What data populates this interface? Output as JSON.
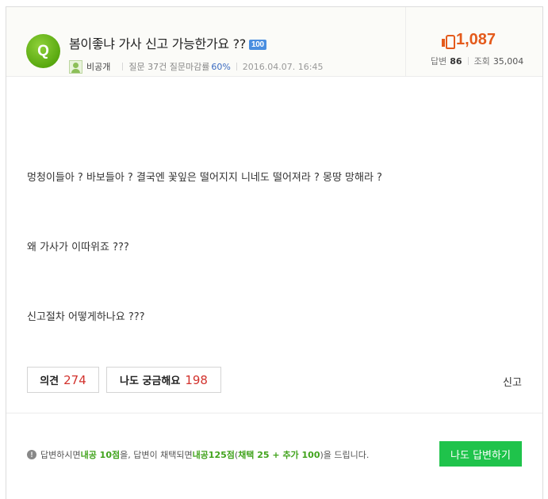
{
  "question": {
    "badge_letter": "Q",
    "title": "봄이좋냐 가사 신고 가능한가요 ??",
    "bounty": "100",
    "author": "비공개",
    "question_count": "질문 37건",
    "close_rate_label": "질문마감률",
    "close_rate_value": "60%",
    "date": "2016.04.07. 16:45",
    "body": [
      "멍청이들아 ? 바보들아 ? 결국엔 꽃잎은 떨어지지 니네도 떨어져라 ? 몽땅 망해라 ?",
      "왜 가사가 이따위죠 ???",
      "신고절차 어떻게하나요 ???"
    ]
  },
  "stats": {
    "likes": "1,087",
    "answers_label": "답변",
    "answers": "86",
    "views_label": "조회",
    "views": "35,004"
  },
  "actions": {
    "opinion_label": "의견",
    "opinion_count": "274",
    "curious_label": "나도 궁금해요",
    "curious_count": "198",
    "report_label": "신고"
  },
  "notice": {
    "icon": "info-icon",
    "part1": "답변하시면 ",
    "highlight1": "내공 10점",
    "part2": "을, 답변이 채택되면 ",
    "highlight2": "내공125점",
    "part3": " (",
    "highlight3": "채택 25 + 추가 100",
    "part4": ")을 드립니다.",
    "button": "나도 답변하기"
  },
  "colors": {
    "likes": "#e45a1b",
    "counts": "#d2322d",
    "answer_button": "#1fc34b",
    "bounty_badge": "#4a8ee0",
    "q_badge": "#58a80f"
  }
}
